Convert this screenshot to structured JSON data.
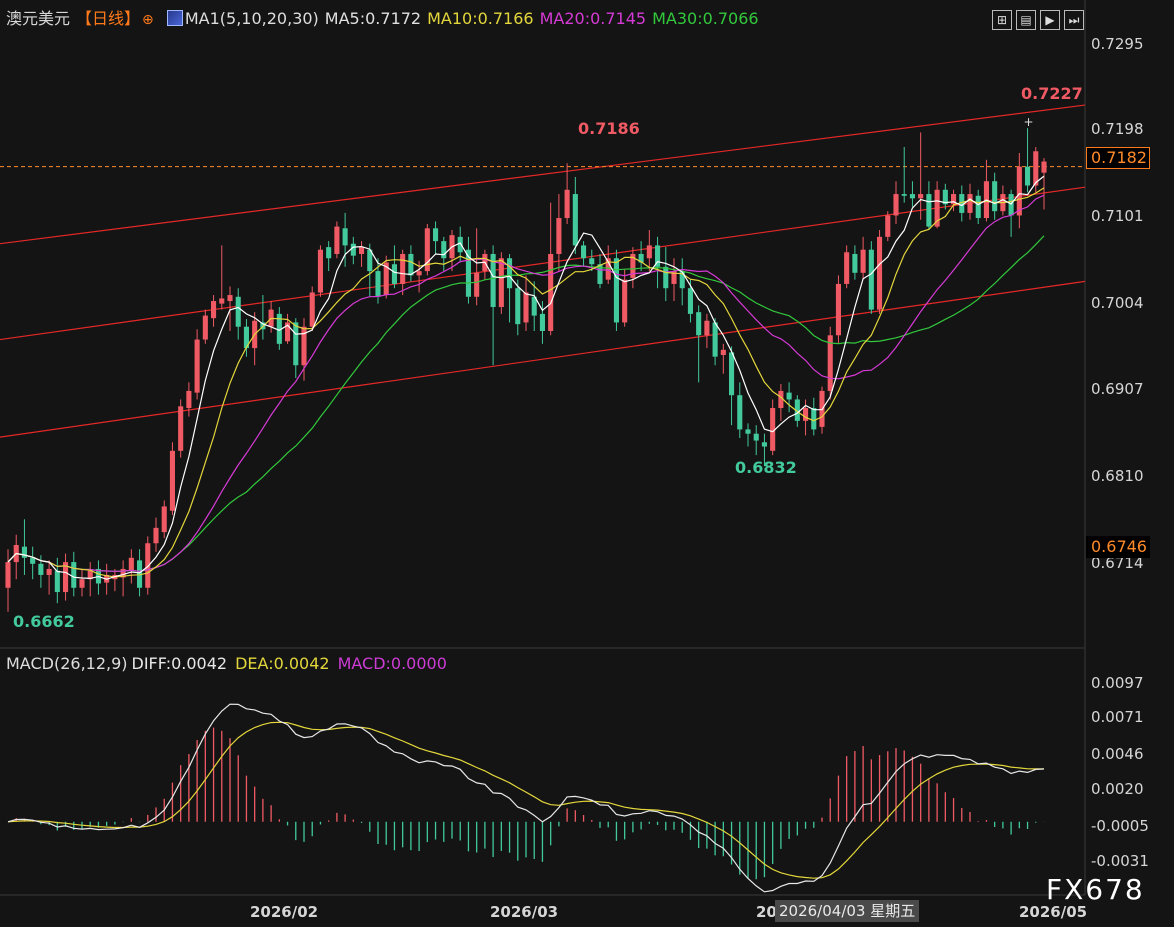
{
  "header": {
    "symbol": "澳元美元",
    "period": "【日线】",
    "settings_icon": "crosshair-icon",
    "chart_icon": "chart-icon",
    "ma_label": "MA1(5,10,20,30)",
    "ma5": "MA5:0.7172",
    "ma10": "MA10:0.7166",
    "ma20": "MA20:0.7145",
    "ma30": "MA30:0.7066"
  },
  "controls": [
    "expand-icon",
    "layout-icon",
    "play-icon",
    "step-icon"
  ],
  "colors": {
    "up": "#f05a64",
    "down": "#42c99c",
    "ma5": "#ffffff",
    "ma10": "#e3d63c",
    "ma20": "#d63ad6",
    "ma30": "#32c83c",
    "channel": "#e52828",
    "price": "#ff8a2a",
    "macd": "#cd3cd4"
  },
  "price_axis": [
    "0.7295",
    "0.7198",
    "0.7101",
    "0.7004",
    "0.6907",
    "0.6810",
    "0.6714"
  ],
  "current_price": "0.7182",
  "marker_price": "0.6746",
  "annotations": {
    "high": "0.7227",
    "peak": "0.7186",
    "low": "0.6832",
    "start_low": "0.6662"
  },
  "macd_header": {
    "label": "MACD(26,12,9)",
    "diff": "DIFF:0.0042",
    "dea": "DEA:0.0042",
    "macd": "MACD:0.0000"
  },
  "macd_axis": [
    "0.0097",
    "0.0071",
    "0.0046",
    "0.0020",
    "-0.0005",
    "-0.0031"
  ],
  "x_axis": [
    "2026/02",
    "2026/03",
    "20",
    "2026/05"
  ],
  "tooltip": "2026/04/03 星期五",
  "watermark": "FX678",
  "chart_data": {
    "type": "candlestick",
    "title": "澳元美元 日线",
    "ylim": [
      0.665,
      0.733
    ],
    "candles": [
      [
        0.669,
        0.672,
        0.6662,
        0.6735
      ],
      [
        0.672,
        0.674,
        0.67,
        0.6752
      ],
      [
        0.6738,
        0.6725,
        0.6705,
        0.677
      ],
      [
        0.6725,
        0.6718,
        0.67,
        0.6738
      ],
      [
        0.6718,
        0.6705,
        0.669,
        0.6728
      ],
      [
        0.6705,
        0.6712,
        0.6682,
        0.6722
      ],
      [
        0.671,
        0.6685,
        0.6672,
        0.6725
      ],
      [
        0.6685,
        0.672,
        0.6675,
        0.673
      ],
      [
        0.672,
        0.669,
        0.668,
        0.6732
      ],
      [
        0.669,
        0.67,
        0.668,
        0.6712
      ],
      [
        0.67,
        0.671,
        0.668,
        0.672
      ],
      [
        0.6712,
        0.6695,
        0.6682,
        0.6722
      ],
      [
        0.6696,
        0.6705,
        0.6682,
        0.6718
      ],
      [
        0.67,
        0.6705,
        0.6686,
        0.6712
      ],
      [
        0.6702,
        0.6712,
        0.668,
        0.6722
      ],
      [
        0.671,
        0.6725,
        0.6695,
        0.6735
      ],
      [
        0.6722,
        0.669,
        0.668,
        0.6735
      ],
      [
        0.669,
        0.6742,
        0.6682,
        0.675
      ],
      [
        0.6742,
        0.676,
        0.6732,
        0.6772
      ],
      [
        0.6755,
        0.6785,
        0.6748,
        0.6792
      ],
      [
        0.678,
        0.685,
        0.6775,
        0.686
      ],
      [
        0.685,
        0.6902,
        0.6842,
        0.691
      ],
      [
        0.69,
        0.692,
        0.689,
        0.693
      ],
      [
        0.6918,
        0.698,
        0.691,
        0.6992
      ],
      [
        0.698,
        0.7008,
        0.6975,
        0.7015
      ],
      [
        0.7005,
        0.7025,
        0.6995,
        0.7032
      ],
      [
        0.7022,
        0.7028,
        0.7015,
        0.709
      ],
      [
        0.7025,
        0.7032,
        0.699,
        0.7042
      ],
      [
        0.703,
        0.6995,
        0.698,
        0.704
      ],
      [
        0.6995,
        0.697,
        0.696,
        0.7004
      ],
      [
        0.697,
        0.7002,
        0.695,
        0.7012
      ],
      [
        0.7,
        0.6992,
        0.698,
        0.7032
      ],
      [
        0.6995,
        0.7015,
        0.6988,
        0.7025
      ],
      [
        0.701,
        0.6975,
        0.6968,
        0.7018
      ],
      [
        0.6978,
        0.7,
        0.6975,
        0.701
      ],
      [
        0.7,
        0.695,
        0.6935,
        0.7005
      ],
      [
        0.695,
        0.6995,
        0.6932,
        0.7005
      ],
      [
        0.6995,
        0.7035,
        0.699,
        0.7042
      ],
      [
        0.7035,
        0.7085,
        0.703,
        0.709
      ],
      [
        0.7088,
        0.7075,
        0.706,
        0.7095
      ],
      [
        0.708,
        0.7112,
        0.7075,
        0.7118
      ],
      [
        0.711,
        0.709,
        0.7065,
        0.7128
      ],
      [
        0.7092,
        0.7078,
        0.7068,
        0.71
      ],
      [
        0.708,
        0.7088,
        0.7065,
        0.7095
      ],
      [
        0.7085,
        0.706,
        0.703,
        0.7092
      ],
      [
        0.706,
        0.703,
        0.7022,
        0.7075
      ],
      [
        0.7032,
        0.707,
        0.7028,
        0.7078
      ],
      [
        0.7068,
        0.7045,
        0.704,
        0.709
      ],
      [
        0.7045,
        0.708,
        0.7032,
        0.7085
      ],
      [
        0.708,
        0.7055,
        0.7048,
        0.709
      ],
      [
        0.7055,
        0.706,
        0.7035,
        0.7072
      ],
      [
        0.706,
        0.711,
        0.7055,
        0.7115
      ],
      [
        0.711,
        0.7095,
        0.708,
        0.7118
      ],
      [
        0.7095,
        0.7075,
        0.706,
        0.71
      ],
      [
        0.7075,
        0.7102,
        0.706,
        0.7108
      ],
      [
        0.71,
        0.7082,
        0.707,
        0.7112
      ],
      [
        0.7085,
        0.703,
        0.7022,
        0.71
      ],
      [
        0.703,
        0.7058,
        0.702,
        0.711
      ],
      [
        0.706,
        0.708,
        0.705,
        0.7085
      ],
      [
        0.708,
        0.7018,
        0.695,
        0.709
      ],
      [
        0.7018,
        0.7075,
        0.701,
        0.7082
      ],
      [
        0.7075,
        0.704,
        0.7,
        0.708
      ],
      [
        0.704,
        0.6998,
        0.6985,
        0.705
      ],
      [
        0.7,
        0.7035,
        0.699,
        0.7055
      ],
      [
        0.703,
        0.7008,
        0.699,
        0.7048
      ],
      [
        0.701,
        0.699,
        0.6975,
        0.7025
      ],
      [
        0.699,
        0.708,
        0.6985,
        0.714
      ],
      [
        0.708,
        0.7122,
        0.706,
        0.715
      ],
      [
        0.7122,
        0.7155,
        0.7115,
        0.7186
      ],
      [
        0.715,
        0.709,
        0.708,
        0.717
      ],
      [
        0.709,
        0.7075,
        0.7065,
        0.7095
      ],
      [
        0.7075,
        0.7068,
        0.706,
        0.7085
      ],
      [
        0.7068,
        0.7045,
        0.704,
        0.708
      ],
      [
        0.705,
        0.7075,
        0.7045,
        0.709
      ],
      [
        0.7075,
        0.7,
        0.699,
        0.7085
      ],
      [
        0.7,
        0.705,
        0.6995,
        0.7062
      ],
      [
        0.7052,
        0.708,
        0.704,
        0.7088
      ],
      [
        0.708,
        0.707,
        0.706,
        0.7095
      ],
      [
        0.7075,
        0.709,
        0.706,
        0.7108
      ],
      [
        0.709,
        0.7065,
        0.704,
        0.71
      ],
      [
        0.7065,
        0.704,
        0.7025,
        0.7088
      ],
      [
        0.7045,
        0.706,
        0.7025,
        0.7075
      ],
      [
        0.706,
        0.704,
        0.702,
        0.7075
      ],
      [
        0.704,
        0.701,
        0.7,
        0.705
      ],
      [
        0.7012,
        0.6985,
        0.693,
        0.702
      ],
      [
        0.6985,
        0.7002,
        0.697,
        0.701
      ],
      [
        0.7,
        0.696,
        0.695,
        0.7005
      ],
      [
        0.6962,
        0.6968,
        0.694,
        0.6975
      ],
      [
        0.6965,
        0.6915,
        0.688,
        0.6972
      ],
      [
        0.6915,
        0.6875,
        0.6865,
        0.693
      ],
      [
        0.6875,
        0.687,
        0.6855,
        0.6882
      ],
      [
        0.687,
        0.6862,
        0.6845,
        0.688
      ],
      [
        0.686,
        0.6855,
        0.6832,
        0.687
      ],
      [
        0.685,
        0.69,
        0.6845,
        0.691
      ],
      [
        0.69,
        0.692,
        0.6885,
        0.6928
      ],
      [
        0.6918,
        0.691,
        0.6895,
        0.693
      ],
      [
        0.691,
        0.6885,
        0.6878,
        0.6915
      ],
      [
        0.6885,
        0.69,
        0.6868,
        0.691
      ],
      [
        0.69,
        0.6875,
        0.6868,
        0.6912
      ],
      [
        0.6878,
        0.692,
        0.687,
        0.6925
      ],
      [
        0.692,
        0.6985,
        0.691,
        0.6995
      ],
      [
        0.6985,
        0.7045,
        0.6975,
        0.7055
      ],
      [
        0.7045,
        0.7082,
        0.704,
        0.709
      ],
      [
        0.708,
        0.7058,
        0.705,
        0.709
      ],
      [
        0.7058,
        0.7085,
        0.705,
        0.71
      ],
      [
        0.7085,
        0.7015,
        0.701,
        0.7095
      ],
      [
        0.7015,
        0.71,
        0.701,
        0.7108
      ],
      [
        0.71,
        0.7125,
        0.7095,
        0.713
      ],
      [
        0.7125,
        0.715,
        0.7115,
        0.7165
      ],
      [
        0.715,
        0.7148,
        0.714,
        0.7205
      ],
      [
        0.715,
        0.7145,
        0.7135,
        0.7165
      ],
      [
        0.7145,
        0.715,
        0.712,
        0.7222
      ],
      [
        0.715,
        0.7112,
        0.7108,
        0.7165
      ],
      [
        0.7112,
        0.7155,
        0.711,
        0.7165
      ],
      [
        0.7155,
        0.7138,
        0.7132,
        0.7162
      ],
      [
        0.7138,
        0.715,
        0.713,
        0.7155
      ],
      [
        0.715,
        0.7128,
        0.7118,
        0.716
      ],
      [
        0.7128,
        0.715,
        0.712,
        0.7162
      ],
      [
        0.7148,
        0.7122,
        0.7115,
        0.7155
      ],
      [
        0.7122,
        0.7165,
        0.7118,
        0.719
      ],
      [
        0.7165,
        0.713,
        0.712,
        0.7175
      ],
      [
        0.713,
        0.715,
        0.7125,
        0.716
      ],
      [
        0.715,
        0.7125,
        0.71,
        0.7155
      ],
      [
        0.7125,
        0.7182,
        0.711,
        0.7198
      ],
      [
        0.7182,
        0.716,
        0.7152,
        0.7227
      ],
      [
        0.716,
        0.72,
        0.7152,
        0.7205
      ],
      [
        0.7175,
        0.7188,
        0.7132,
        0.7192
      ]
    ]
  }
}
